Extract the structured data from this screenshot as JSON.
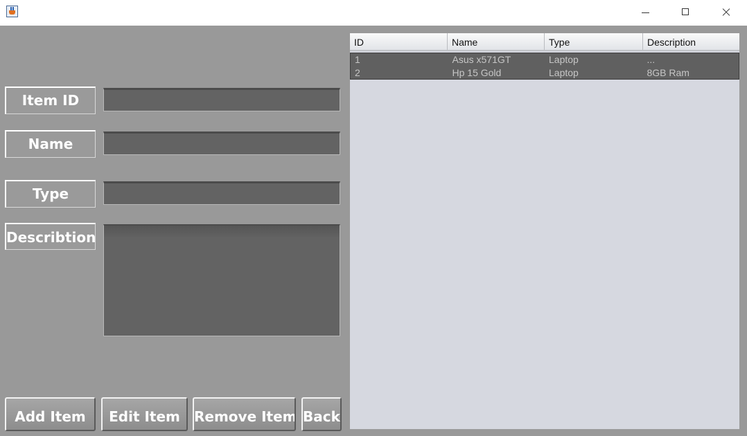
{
  "form": {
    "labels": {
      "item_id": "Item ID",
      "name": "Name",
      "type": "Type",
      "description": "Describtion"
    },
    "values": {
      "item_id": "",
      "name": "",
      "type": "",
      "description": ""
    }
  },
  "buttons": {
    "add": "Add Item",
    "edit": "Edit Item",
    "remove": "Remove Item",
    "back": "Back"
  },
  "table": {
    "columns": [
      "ID",
      "Name",
      "Type",
      "Description"
    ],
    "rows": [
      [
        "1",
        "Asus x571GT",
        "Laptop",
        "..."
      ],
      [
        "2",
        "Hp 15 Gold",
        "Laptop",
        "8GB Ram"
      ]
    ]
  },
  "icons": {
    "app": "java-cup-icon",
    "minimize": "minimize-icon",
    "maximize": "maximize-icon",
    "close": "close-icon"
  },
  "colors": {
    "background": "#999999",
    "input_fill": "#636363",
    "table_area": "#d6d8e0",
    "row_fill": "#606060",
    "label_text": "#ffffff"
  }
}
